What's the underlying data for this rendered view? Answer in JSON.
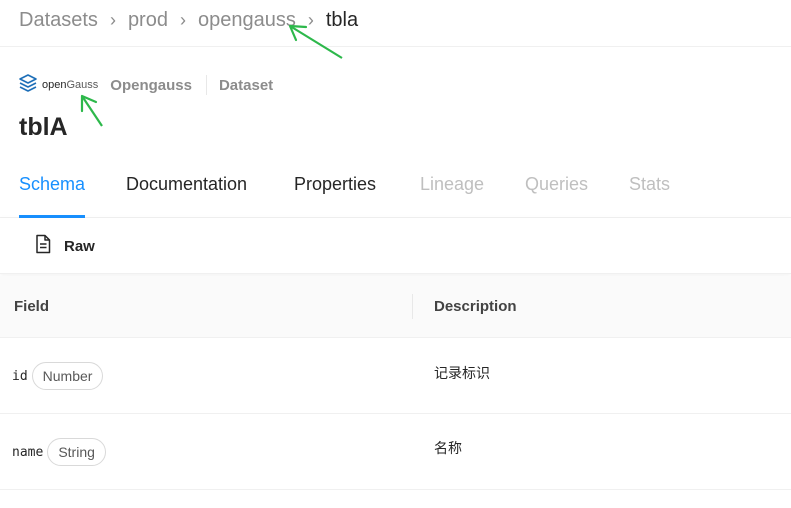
{
  "breadcrumb": {
    "items": [
      "Datasets",
      "prod",
      "opengauss"
    ],
    "current": "tbla",
    "separator": "›"
  },
  "platform": {
    "logo_text_open": "open",
    "logo_text_gauss": "Gauss",
    "name": "Opengauss",
    "entity_type": "Dataset"
  },
  "entity": {
    "title": "tblA"
  },
  "tabs": [
    {
      "label": "Schema",
      "state": "active"
    },
    {
      "label": "Documentation",
      "state": "normal"
    },
    {
      "label": "Properties",
      "state": "normal"
    },
    {
      "label": "Lineage",
      "state": "disabled"
    },
    {
      "label": "Queries",
      "state": "disabled"
    },
    {
      "label": "Stats",
      "state": "disabled"
    }
  ],
  "toolbar": {
    "raw_label": "Raw"
  },
  "table": {
    "columns": [
      "Field",
      "Description"
    ],
    "rows": [
      {
        "field": "id",
        "type": "Number",
        "description": "记录标识"
      },
      {
        "field": "name",
        "type": "String",
        "description": "名称"
      }
    ]
  },
  "colors": {
    "accent": "#1890ff",
    "annotation_arrow": "#2db84b",
    "logo_blue": "#1e6fb8"
  },
  "icons": {
    "logo": "opengauss-layers-icon",
    "raw": "file-text-icon",
    "annotation": "green-arrow-annotation"
  }
}
